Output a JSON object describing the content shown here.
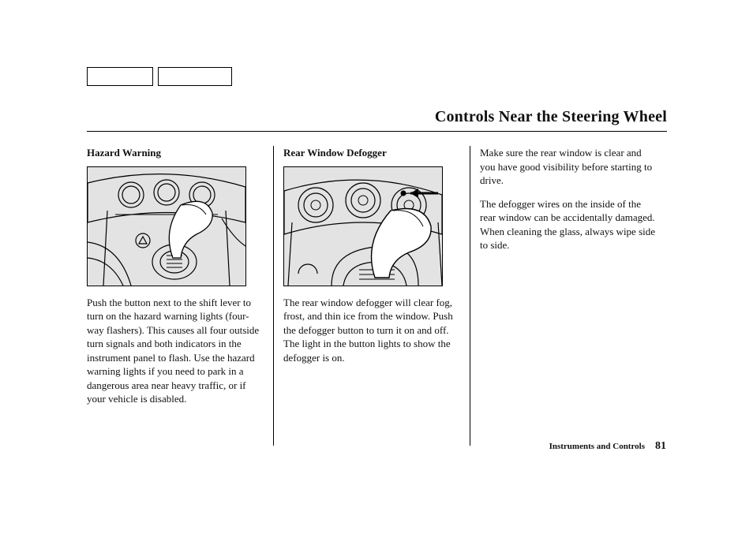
{
  "page_title": "Controls Near the Steering Wheel",
  "footer": {
    "section": "Instruments and Controls",
    "page_number": "81"
  },
  "col1": {
    "heading": "Hazard Warning",
    "p1": "Push the button next to the shift lever to turn on the hazard warning lights (four-way flashers). This causes all four outside turn signals and both indicators in the instrument panel to flash. Use the hazard warning lights if you need to park in a dangerous area near heavy traffic, or if your vehicle is disabled."
  },
  "col2": {
    "heading": "Rear Window Defogger",
    "p1": "The rear window defogger will clear fog, frost, and thin ice from the window. Push the defogger button to turn it on and off. The light in the button lights to show the defogger is on."
  },
  "col3": {
    "p1": "Make sure the rear window is clear and you have good visibility before starting to drive.",
    "p2": "The defogger wires on the inside of the rear window can be accidentally damaged. When cleaning the glass, always wipe side to side."
  }
}
